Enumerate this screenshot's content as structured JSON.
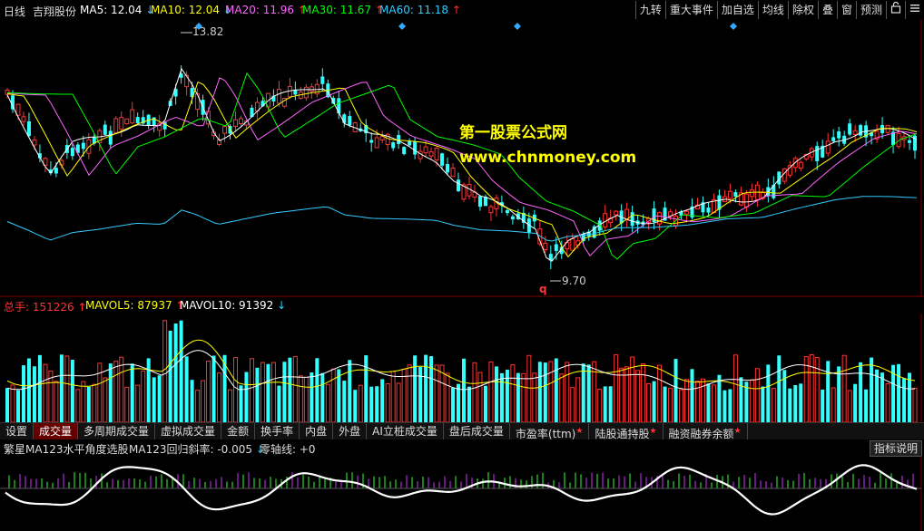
{
  "header": {
    "period": "日线",
    "stock_name": "吉翔股份",
    "ma": [
      {
        "label": "MA5: 12.04",
        "arrow": "↓",
        "color": "#ffffff"
      },
      {
        "label": "MA10: 12.04",
        "arrow": "↓",
        "color": "#ffff00"
      },
      {
        "label": "MA20: 11.96",
        "arrow": "↑",
        "color": "#ff66ff"
      },
      {
        "label": "MA30: 11.67",
        "arrow": "↑",
        "color": "#00ff00"
      },
      {
        "label": "MA60: 11.18",
        "arrow": "↑",
        "color": "#33ccff"
      }
    ]
  },
  "toolbar": {
    "items": [
      "九转",
      "重大事件",
      "加自选",
      "均线",
      "除权",
      "叠",
      "窗",
      "预测"
    ],
    "icon_lock": "lock-icon",
    "icon_menu": "menu-icon"
  },
  "price_panel": {
    "high_label": "13.82",
    "low_label": "9.70",
    "low_marker": "q",
    "watermark_title": "第一股票公式网",
    "watermark_url": "www.chnmoney.com"
  },
  "volume_panel": {
    "total_label": "总手: 151226",
    "total_arrow": "↑",
    "mavol5_label": "MAVOL5: 87937",
    "mavol5_arrow": "↑",
    "mavol10_label": "MAVOL10: 91392",
    "mavol10_arrow": "↓"
  },
  "tabs": [
    {
      "label": "设置",
      "active": false,
      "star": false
    },
    {
      "label": "成交量",
      "active": true,
      "star": false
    },
    {
      "label": "多周期成交量",
      "active": false,
      "star": false
    },
    {
      "label": "虚拟成交量",
      "active": false,
      "star": false
    },
    {
      "label": "金额",
      "active": false,
      "star": false
    },
    {
      "label": "换手率",
      "active": false,
      "star": false
    },
    {
      "label": "内盘",
      "active": false,
      "star": false
    },
    {
      "label": "外盘",
      "active": false,
      "star": false
    },
    {
      "label": "AI立桩成交量",
      "active": false,
      "star": false
    },
    {
      "label": "盘后成交量",
      "active": false,
      "star": false
    },
    {
      "label": "市盈率(ttm)",
      "active": false,
      "star": true
    },
    {
      "label": "陆股通持股",
      "active": false,
      "star": true
    },
    {
      "label": "融资融券余额",
      "active": false,
      "star": true
    }
  ],
  "indicator_panel": {
    "name": "繁星MA123水平角度选股",
    "slope_label": "MA123回归斜率: -0.005",
    "slope_arrow": "↓",
    "zero_label": "零轴线: +0",
    "help_button": "指标说明"
  },
  "colors": {
    "up": "#ff3333",
    "down": "#33ffff",
    "ma5": "#ffffff",
    "ma10": "#ffff00",
    "ma20": "#ff66ff",
    "ma30": "#00ff00",
    "ma60": "#33ccff",
    "grid": "#800000"
  }
}
